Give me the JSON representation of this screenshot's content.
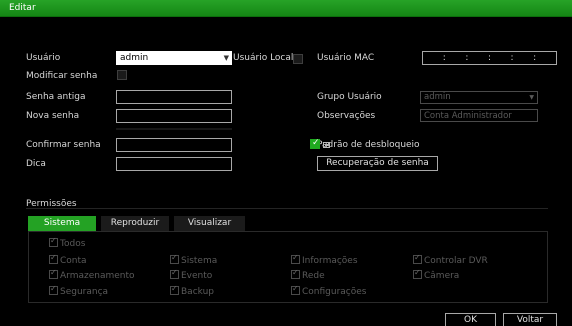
{
  "window": {
    "title": "Editar"
  },
  "form": {
    "user_label": "Usuário",
    "user_value": "admin",
    "local_user_label": "Usuário Local",
    "mac_label": "Usuário MAC",
    "mac_separators": [
      ":",
      ":",
      ":",
      ":",
      ":"
    ],
    "modify_password_label": "Modificar senha",
    "old_password_label": "Senha antiga",
    "new_password_label": "Nova senha",
    "confirm_password_label": "Confirmar senha",
    "hint_label": "Dica",
    "group_label": "Grupo Usuário",
    "group_value": "admin",
    "notes_label": "Observações",
    "notes_value": "Conta Administrador",
    "unlock_pattern_label": "Padrão de desbloqueio",
    "password_recovery_button": "Recuperação de senha"
  },
  "permissions": {
    "section_label": "Permissões",
    "tabs": [
      "Sistema",
      "Reproduzir",
      "Visualizar"
    ],
    "active_tab": "Sistema",
    "all_label": "Todos",
    "items": [
      [
        "Conta",
        "Sistema",
        "Informações",
        "Controlar DVR"
      ],
      [
        "Armazenamento",
        "Evento",
        "Rede",
        "Câmera"
      ],
      [
        "Segurança",
        "Backup",
        "Configurações"
      ]
    ]
  },
  "footer": {
    "ok_label": "OK",
    "back_label": "Voltar"
  },
  "colors": {
    "accent": "#24a224",
    "title_bar": "#1e9a1e",
    "background": "#000000"
  },
  "icons": {
    "dropdown": "chevron-down-icon",
    "pattern": "unlock-pattern-icon",
    "checkbox": "checkbox-icon"
  }
}
